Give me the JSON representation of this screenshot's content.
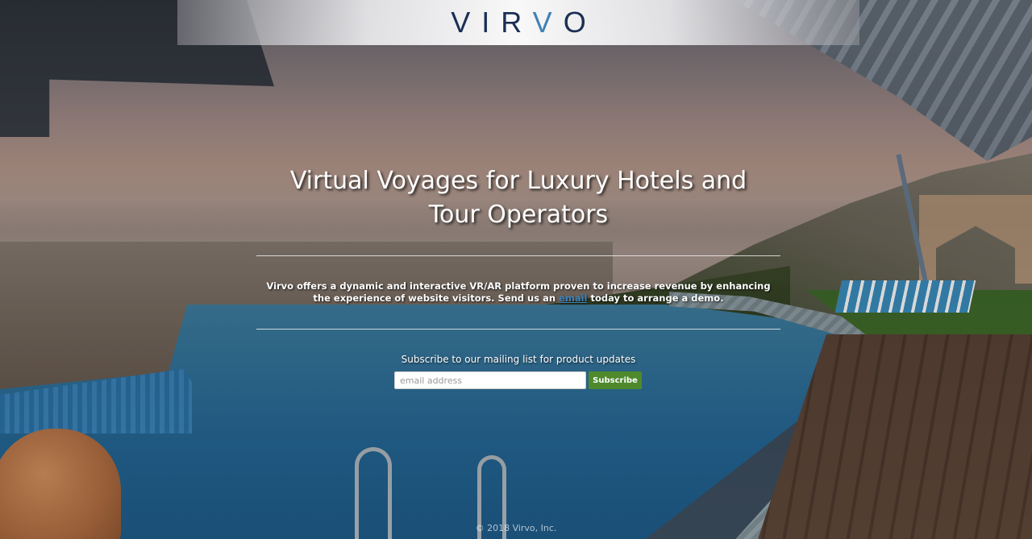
{
  "header": {
    "logo_part1": "VIR",
    "logo_accent": "V",
    "logo_part2": "O"
  },
  "hero": {
    "headline": "Virtual Voyages for Luxury Hotels and Tour Operators",
    "description_before_link": "Virvo offers a dynamic and interactive VR/AR platform proven to increase revenue by enhancing the experience of website visitors. Send us an ",
    "description_link": "email",
    "description_after_link": " today to arrange a demo."
  },
  "subscribe": {
    "label": "Subscribe to our mailing list for product updates",
    "input_placeholder": "email address",
    "input_value": "",
    "button_label": "Subscribe"
  },
  "footer": {
    "copyright": "© 2018 Virvo, Inc."
  },
  "colors": {
    "logo_navy": "#1b2f54",
    "logo_blue": "#3f82b8",
    "link": "#3f82b8",
    "button_green": "#4e8a2c",
    "text": "#ffffff"
  }
}
